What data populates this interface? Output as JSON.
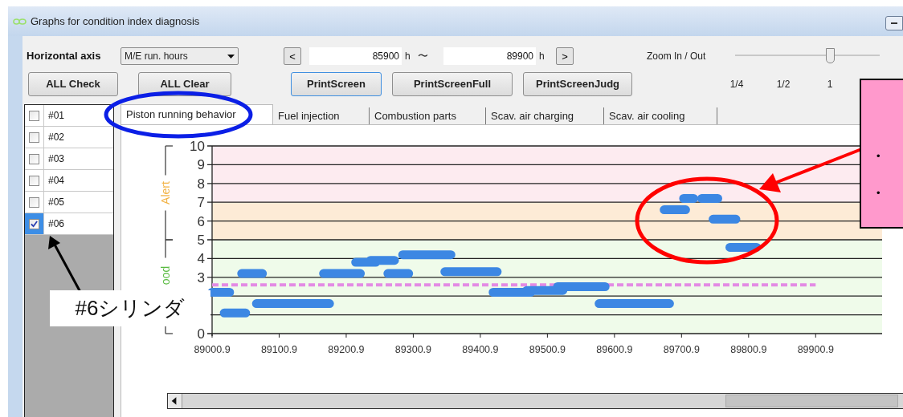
{
  "window": {
    "title": "Graphs for condition index diagnosis"
  },
  "controls": {
    "axis_label": "Horizontal axis",
    "axis_select": "M/E run. hours",
    "prev_button": "<",
    "from_value": "85900",
    "from_unit": "h",
    "range_separator": "〜",
    "to_value": "89900",
    "to_unit": "h",
    "next_button": ">",
    "zoom_label": "Zoom In / Out",
    "zoom": {
      "level": 0.655,
      "tick_labels": [
        "1/4",
        "1/2",
        "1"
      ]
    }
  },
  "buttons": [
    {
      "label": "ALL Check"
    },
    {
      "label": "ALL Clear"
    }
  ],
  "print_buttons": [
    {
      "label": "PrintScreen",
      "focused": true
    },
    {
      "label": "PrintScreenFull",
      "focused": false
    },
    {
      "label": "PrintScreenJudg",
      "focused": false
    }
  ],
  "cylinders": [
    {
      "label": "#01",
      "checked": false,
      "selected": false
    },
    {
      "label": "#02",
      "checked": false,
      "selected": false
    },
    {
      "label": "#03",
      "checked": false,
      "selected": false
    },
    {
      "label": "#04",
      "checked": false,
      "selected": false
    },
    {
      "label": "#05",
      "checked": false,
      "selected": false
    },
    {
      "label": "#06",
      "checked": true,
      "selected": true
    }
  ],
  "tabs": [
    {
      "label": "Piston running behavior",
      "selected": true
    },
    {
      "label": "Fuel injection",
      "selected": false
    },
    {
      "label": "Combustion parts",
      "selected": false
    },
    {
      "label": "Scav. air charging",
      "selected": false
    },
    {
      "label": "Scav. air cooling",
      "selected": false
    }
  ],
  "chart": {
    "chart_data": {
      "type": "line",
      "x": [
        89000.9,
        89027,
        null,
        89019,
        89051,
        null,
        89045,
        89076,
        null,
        89067,
        89176,
        null,
        89167,
        89222,
        null,
        89215,
        89245,
        null,
        89237,
        89273,
        null,
        89263,
        89294,
        null,
        89285,
        89357,
        null,
        89348,
        89426,
        null,
        89420,
        89476,
        null,
        89470,
        89524,
        null,
        89516,
        89587,
        null,
        89578,
        89683,
        null,
        89675,
        89707,
        null,
        89704,
        89719,
        null,
        89731,
        89755,
        null,
        89748,
        89782,
        null,
        89773,
        89813
      ],
      "series": [
        {
          "color": "#3c87e3",
          "values": [
            2.2,
            2.2,
            null,
            1.1,
            1.1,
            null,
            3.2,
            3.2,
            null,
            1.6,
            1.6,
            null,
            3.2,
            3.2,
            null,
            3.8,
            3.8,
            null,
            3.9,
            3.9,
            null,
            3.2,
            3.2,
            null,
            4.2,
            4.2,
            null,
            3.3,
            3.3,
            null,
            2.2,
            2.2,
            null,
            2.3,
            2.3,
            null,
            2.5,
            2.5,
            null,
            1.6,
            1.6,
            null,
            6.6,
            6.6,
            null,
            7.2,
            7.2,
            null,
            7.2,
            7.2,
            null,
            6.1,
            6.1,
            null,
            4.6,
            4.6
          ]
        }
      ],
      "xlim": [
        89000.9,
        90000
      ],
      "ylim": [
        0,
        10
      ],
      "xticks": [
        89000.9,
        89100.9,
        89200.9,
        89300.9,
        89400.9,
        89500.9,
        89600.9,
        89700.9,
        89800.9,
        89900.9
      ],
      "yticks": [
        0,
        3,
        4,
        5,
        6,
        7,
        8,
        9,
        10
      ],
      "grid": true,
      "bands": [
        {
          "axis": "y",
          "from": 0,
          "to": 5,
          "color": "#effbea"
        },
        {
          "axis": "y",
          "from": 5,
          "to": 7,
          "color": "#fdebd6"
        },
        {
          "axis": "y",
          "from": 7,
          "to": 10,
          "color": "#fdebf0"
        }
      ],
      "ref_lines": [
        {
          "axis": "y",
          "value": 2.6,
          "color": "#e38be4"
        }
      ]
    },
    "range_labels": [
      {
        "text": "Alert",
        "color": "#f2b244"
      },
      {
        "text": "ood",
        "color": "#58bb40"
      }
    ]
  },
  "annotations": {
    "callout": "#6シリンダ",
    "note_bullets": [
      "・",
      "・"
    ]
  }
}
